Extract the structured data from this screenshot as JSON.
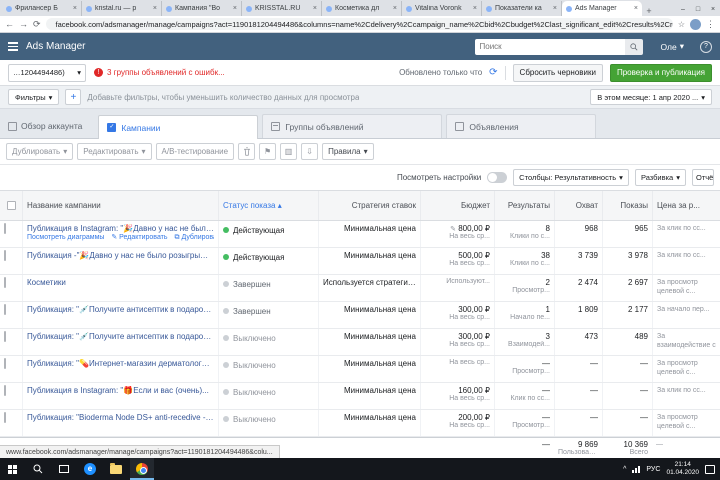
{
  "colors": {
    "accent_blue": "#3578e5",
    "green_button": "#45a335",
    "active_status_green": "#45bd62",
    "header_bg": "#42617e",
    "warning_red": "#e02828"
  },
  "browser": {
    "tab_close": "×",
    "new_tab": "+",
    "window_controls": {
      "minimize": "–",
      "maximize": "□",
      "close": "×"
    },
    "tabs": [
      {
        "label": "Фрилансер Б",
        "active": false
      },
      {
        "label": "kristal.ru — р",
        "active": false
      },
      {
        "label": "Кампания \"Во",
        "active": false
      },
      {
        "label": "KRISSTAL.RU",
        "active": false
      },
      {
        "label": "Косметика дл",
        "active": false
      },
      {
        "label": "Vitalina Voronk",
        "active": false
      },
      {
        "label": "Показатели ка",
        "active": false
      },
      {
        "label": "Ads Manager",
        "active": true
      }
    ],
    "url": "facebook.com/adsmanager/manage/campaigns?act=1190181204494486&columns=name%2Cdelivery%2Ccampaign_name%2Cbid%2Cbudget%2Clast_significant_edit%2Cresults%2Creach%2Cimpre",
    "status_link": "www.facebook.com/adsmanager/manage/campaigns?act=1190181204494486&colu..."
  },
  "header": {
    "title": "Ads Manager",
    "search_placeholder": "Поиск",
    "user_name": "Оле",
    "help": "?"
  },
  "account_bar": {
    "account_label": "…1204494486)",
    "warning": "3 группы объявлений с ошибк...",
    "updated": "Обновлено только что",
    "discard_button": "Сбросить черновики",
    "publish_button": "Проверка и публикация"
  },
  "filter_bar": {
    "filters": "Фильтры",
    "add": "+",
    "hint": "Добавьте фильтры, чтобы уменьшить количество данных для просмотра",
    "date_range": "В этом месяце: 1 апр 2020 ..."
  },
  "nav_tabs": {
    "account_overview": "Обзор аккаунта",
    "campaigns": "Кампании",
    "adsets": "Группы объявлений",
    "ads": "Объявления"
  },
  "toolbar": {
    "duplicate": "Дублировать",
    "edit": "Редактировать",
    "ab_test": "A/B-тестирование",
    "rules": "Правила"
  },
  "view_bar": {
    "view_settings": "Посмотреть настройки",
    "columns": "Столбцы: Результативность",
    "breakdown": "Разбивка",
    "reports": "Отчёты"
  },
  "table": {
    "headers": {
      "name": "Название кампании",
      "delivery": "Статус показа",
      "sort_caret": "▴",
      "bid": "Стратегия ставок",
      "budget": "Бюджет",
      "results": "Результаты",
      "reach": "Охват",
      "impressions": "Показы",
      "cost": "Цена за р..."
    },
    "rows": [
      {
        "name": "Публикация в Instagram: \"🎉Давно у нас не было...",
        "name_edit": "✎",
        "link_charts": "Посмотреть диаграммы",
        "link_edit": "✎ Редактировать",
        "link_duplicate": "⧉ Дублировать",
        "status": "Действующая",
        "status_type": "active",
        "bid": "Минимальная цена",
        "budget_edit": "✎",
        "budget": "800,00 ₽",
        "budget_sub": "На весь ср...",
        "results": "8",
        "results_sub": "Клики по с...",
        "reach": "968",
        "impressions": "965",
        "cost": "За клик по сс..."
      },
      {
        "name": "Публикация -\"🎉Давно у нас не было розыгрышей!.. Пора...\"",
        "status": "Действующая",
        "status_type": "active",
        "bid": "Минимальная цена",
        "budget": "500,00 ₽",
        "budget_sub": "На весь ср...",
        "results": "38",
        "results_sub": "Клики по с...",
        "reach": "3 739",
        "impressions": "3 978",
        "cost": "За клик по сс..."
      },
      {
        "name": "Косметики",
        "status": "Завершен",
        "status_type": "completed",
        "bid": "Используется стратегия ст...",
        "budget": "",
        "budget_sub": "Используют...",
        "results": "2",
        "results_sub": "Просмотр...",
        "reach": "2 474",
        "impressions": "2 697",
        "cost": "За просмотр целевой с..."
      },
      {
        "name": "Публикация: \"💉Получите антисептик в подарок,при заказе...\"",
        "status": "Завершен",
        "status_type": "completed",
        "bid": "Минимальная цена",
        "budget": "300,00 ₽",
        "budget_sub": "На весь ср...",
        "results": "1",
        "results_sub": "Начало пе...",
        "reach": "1 809",
        "impressions": "2 177",
        "cost": "За начало пер..."
      },
      {
        "name": "Публикация: \"💉Получите антисептик в подарок,при заказе...\"",
        "status": "Выключено",
        "status_type": "off",
        "bid": "Минимальная цена",
        "budget": "300,00 ₽",
        "budget_sub": "На весь ср...",
        "results": "3",
        "results_sub": "Взаимодей...",
        "reach": "473",
        "impressions": "489",
        "cost": "За взаимодействие с ..."
      },
      {
        "name": "Публикация: \"💊Интернет-магазин дерматологической косметики...\"",
        "status": "Выключено",
        "status_type": "off",
        "bid": "Минимальная цена",
        "budget": "",
        "budget_sub": "На весь ср...",
        "results": "—",
        "results_sub": "Просмотр...",
        "reach": "—",
        "impressions": "—",
        "cost": "За просмотр целевой с..."
      },
      {
        "name": "Публикация в Instagram: \"🎁Если и вас (очень)...",
        "status": "Выключено",
        "status_type": "off",
        "bid": "Минимальная цена",
        "budget": "160,00 ₽",
        "budget_sub": "На весь ср...",
        "results": "—",
        "results_sub": "Клик по сс...",
        "reach": "—",
        "impressions": "—",
        "cost": "За клик по сс..."
      },
      {
        "name": "Публикация: \"Bioderma Node DS+ anti-recedive - Шампунь🍃...",
        "status": "Выключено",
        "status_type": "off",
        "bid": "Минимальная цена",
        "budget": "200,00 ₽",
        "budget_sub": "На весь ср...",
        "results": "—",
        "results_sub": "Просмотр...",
        "reach": "—",
        "impressions": "—",
        "cost": "За просмотр целевой с..."
      }
    ],
    "totals": {
      "results": "—",
      "reach": "9 869",
      "reach_sub": "Пользовател...",
      "impressions": "10 369",
      "impressions_sub": "Всего",
      "cost": "—"
    }
  },
  "taskbar": {
    "language": "РУС",
    "time": "21:14",
    "date": "01.04.2020"
  }
}
